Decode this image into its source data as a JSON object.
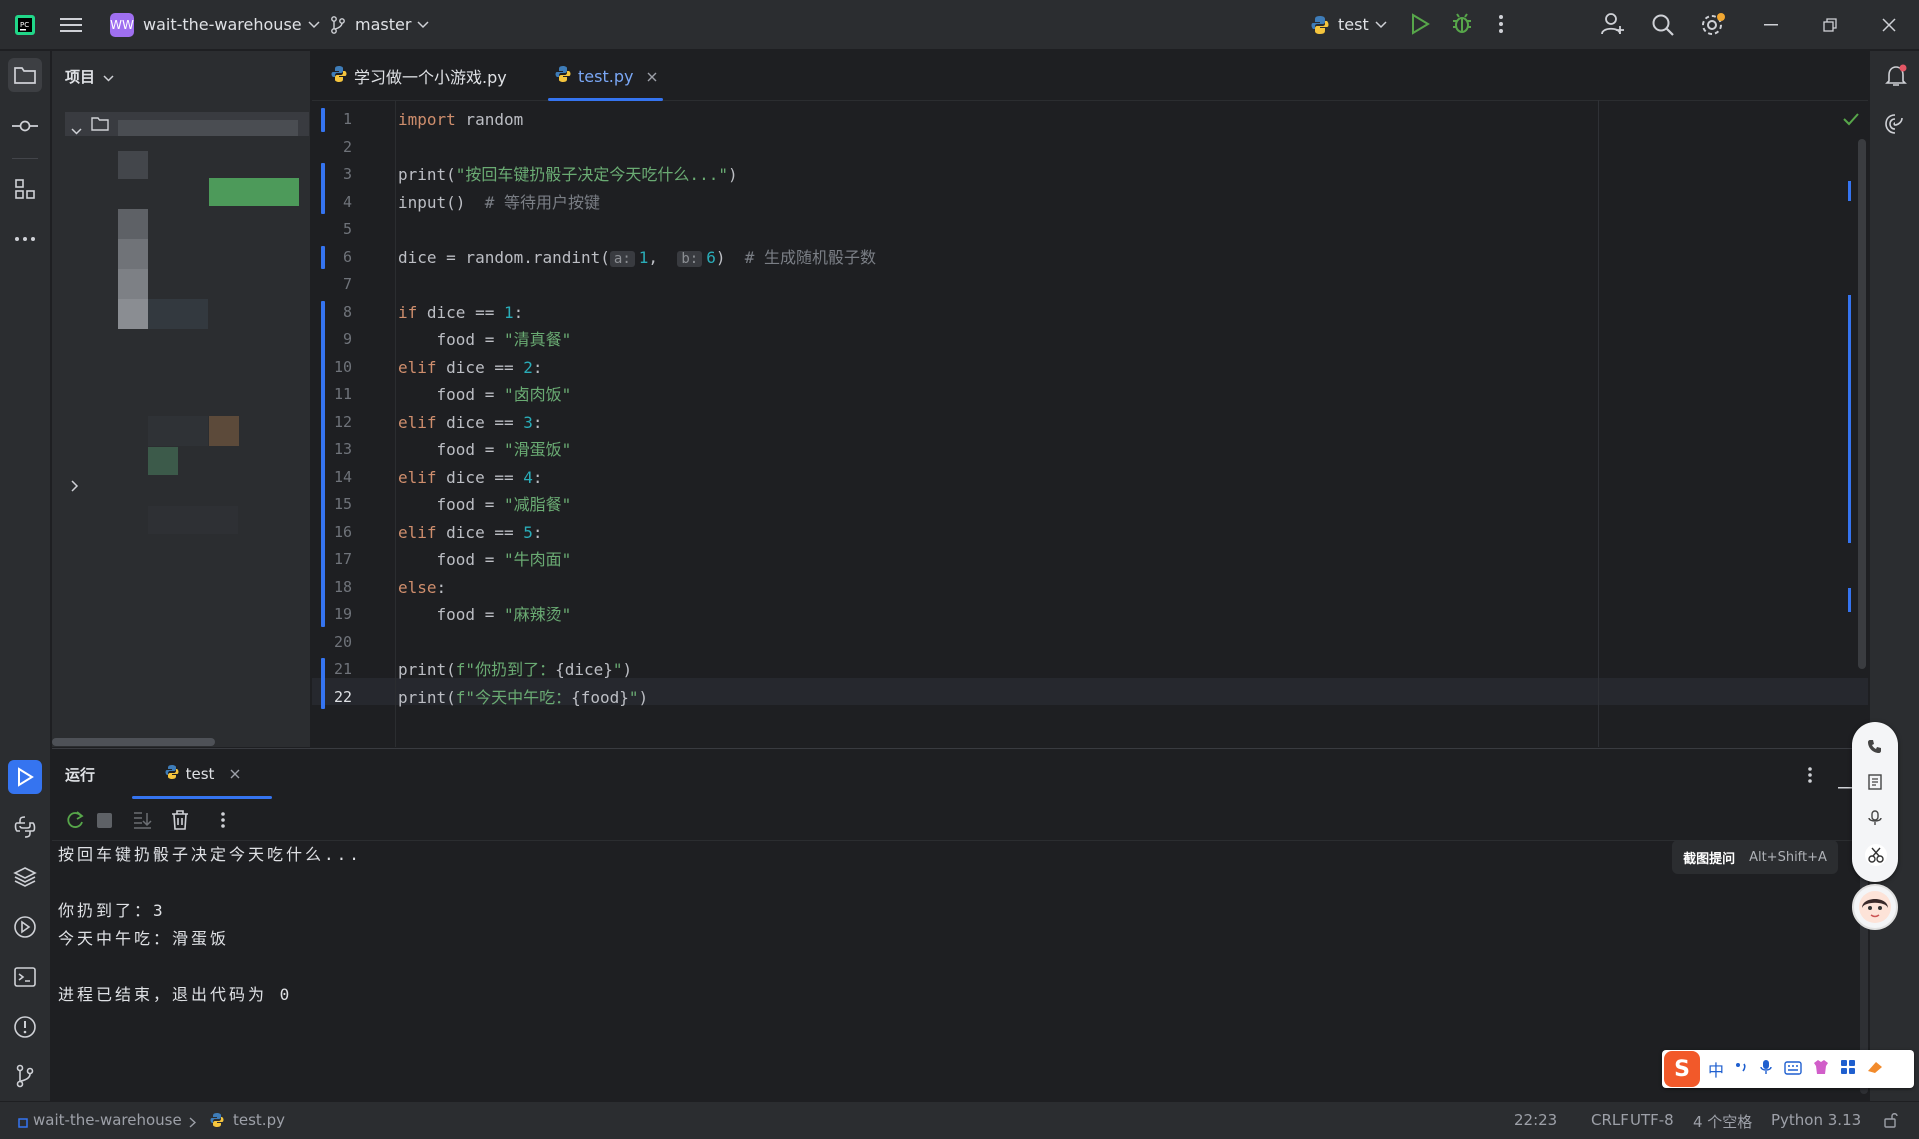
{
  "titlebar": {
    "project_initials": "WW",
    "project_name": "wait-the-warehouse",
    "branch": "master",
    "run_config": "test"
  },
  "sidebar": {
    "panel_title": "项目"
  },
  "editor": {
    "tabs": [
      {
        "label": "学习做一个小游戏.py",
        "active": false
      },
      {
        "label": "test.py",
        "active": true
      }
    ],
    "lines": [
      {
        "n": "1",
        "parts": [
          {
            "t": "import",
            "c": "kw"
          },
          {
            "t": " random",
            "c": ""
          }
        ]
      },
      {
        "n": "2",
        "parts": []
      },
      {
        "n": "3",
        "parts": [
          {
            "t": "print(",
            "c": ""
          },
          {
            "t": "\"按回车键扔骰子决定今天吃什么...\"",
            "c": "st"
          },
          {
            "t": ")",
            "c": ""
          }
        ]
      },
      {
        "n": "4",
        "parts": [
          {
            "t": "input()  ",
            "c": ""
          },
          {
            "t": "# 等待用户按键",
            "c": "cm"
          }
        ]
      },
      {
        "n": "5",
        "parts": []
      },
      {
        "n": "6",
        "parts": [
          {
            "t": "dice = random.randint(",
            "c": ""
          },
          {
            "t": "a:",
            "c": "hint"
          },
          {
            "t": "1",
            "c": "nm"
          },
          {
            "t": ",  ",
            "c": ""
          },
          {
            "t": "b:",
            "c": "hint"
          },
          {
            "t": "6",
            "c": "nm"
          },
          {
            "t": ")  ",
            "c": ""
          },
          {
            "t": "# 生成随机骰子数",
            "c": "cm"
          }
        ]
      },
      {
        "n": "7",
        "parts": []
      },
      {
        "n": "8",
        "parts": [
          {
            "t": "if",
            "c": "kw"
          },
          {
            "t": " dice == ",
            "c": ""
          },
          {
            "t": "1",
            "c": "nm"
          },
          {
            "t": ":",
            "c": ""
          }
        ]
      },
      {
        "n": "9",
        "parts": [
          {
            "t": "    food = ",
            "c": ""
          },
          {
            "t": "\"清真餐\"",
            "c": "st"
          }
        ]
      },
      {
        "n": "10",
        "parts": [
          {
            "t": "elif",
            "c": "kw"
          },
          {
            "t": " dice == ",
            "c": ""
          },
          {
            "t": "2",
            "c": "nm"
          },
          {
            "t": ":",
            "c": ""
          }
        ]
      },
      {
        "n": "11",
        "parts": [
          {
            "t": "    food = ",
            "c": ""
          },
          {
            "t": "\"卤肉饭\"",
            "c": "st"
          }
        ]
      },
      {
        "n": "12",
        "parts": [
          {
            "t": "elif",
            "c": "kw"
          },
          {
            "t": " dice == ",
            "c": ""
          },
          {
            "t": "3",
            "c": "nm"
          },
          {
            "t": ":",
            "c": ""
          }
        ]
      },
      {
        "n": "13",
        "parts": [
          {
            "t": "    food = ",
            "c": ""
          },
          {
            "t": "\"滑蛋饭\"",
            "c": "st"
          }
        ]
      },
      {
        "n": "14",
        "parts": [
          {
            "t": "elif",
            "c": "kw"
          },
          {
            "t": " dice == ",
            "c": ""
          },
          {
            "t": "4",
            "c": "nm"
          },
          {
            "t": ":",
            "c": ""
          }
        ]
      },
      {
        "n": "15",
        "parts": [
          {
            "t": "    food = ",
            "c": ""
          },
          {
            "t": "\"减脂餐\"",
            "c": "st"
          }
        ]
      },
      {
        "n": "16",
        "parts": [
          {
            "t": "elif",
            "c": "kw"
          },
          {
            "t": " dice == ",
            "c": ""
          },
          {
            "t": "5",
            "c": "nm"
          },
          {
            "t": ":",
            "c": ""
          }
        ]
      },
      {
        "n": "17",
        "parts": [
          {
            "t": "    food = ",
            "c": ""
          },
          {
            "t": "\"牛肉面\"",
            "c": "st"
          }
        ]
      },
      {
        "n": "18",
        "parts": [
          {
            "t": "else",
            "c": "kw"
          },
          {
            "t": ":",
            "c": ""
          }
        ]
      },
      {
        "n": "19",
        "parts": [
          {
            "t": "    food = ",
            "c": ""
          },
          {
            "t": "\"麻辣烫\"",
            "c": "st"
          }
        ]
      },
      {
        "n": "20",
        "parts": []
      },
      {
        "n": "21",
        "parts": [
          {
            "t": "print(",
            "c": ""
          },
          {
            "t": "f\"你扔到了：",
            "c": "st"
          },
          {
            "t": "{dice}",
            "c": ""
          },
          {
            "t": "\"",
            "c": "st"
          },
          {
            "t": ")",
            "c": ""
          }
        ]
      },
      {
        "n": "22",
        "parts": [
          {
            "t": "print(",
            "c": ""
          },
          {
            "t": "f\"今天中午吃：",
            "c": "st"
          },
          {
            "t": "{food}",
            "c": ""
          },
          {
            "t": "\"",
            "c": "st"
          },
          {
            "t": ")",
            "c": ""
          }
        ]
      }
    ]
  },
  "run": {
    "title": "运行",
    "tab_label": "test",
    "output": [
      "按回车键扔骰子决定今天吃什么...",
      "",
      "你扔到了：3",
      "今天中午吃：滑蛋饭",
      "",
      "进程已结束，退出代码为 0"
    ]
  },
  "ime": {
    "screenshot_label": "截图提问",
    "screenshot_shortcut": "Alt+Shift+A",
    "mode_char": "中"
  },
  "status": {
    "project": "wait-the-warehouse",
    "file": "test.py",
    "position": "22:23",
    "line_sep": "CRLF",
    "encoding": "UTF-8",
    "indent": "4 个空格",
    "interpreter": "Python 3.13"
  },
  "colors": {
    "accent": "#3574f0",
    "keyword": "#cf8e6d",
    "string": "#6aab73",
    "number": "#2aacb8",
    "comment": "#7a7e85"
  }
}
